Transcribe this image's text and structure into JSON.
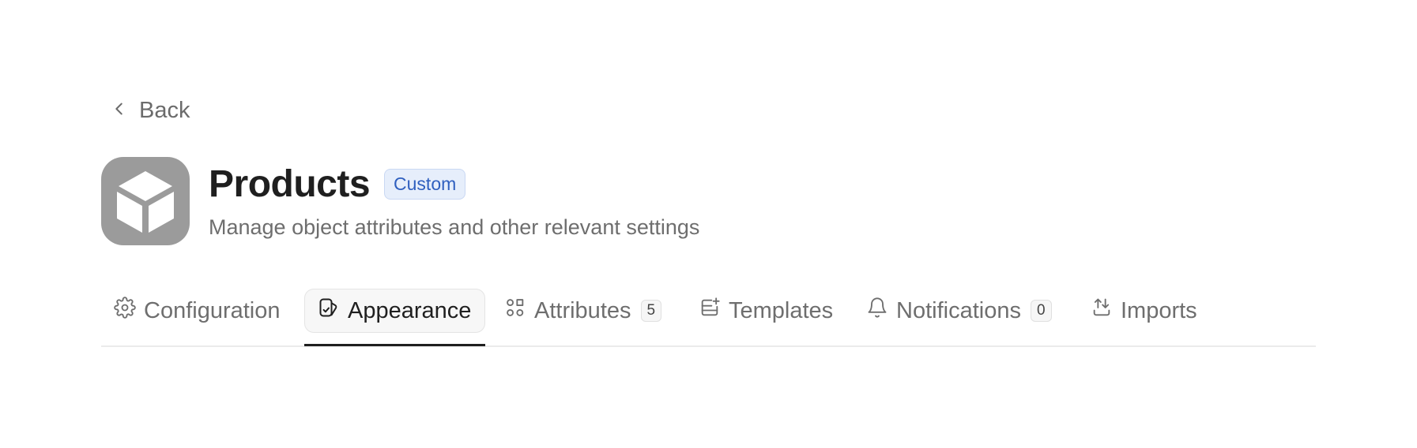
{
  "nav": {
    "back_label": "Back"
  },
  "header": {
    "icon": "cube-icon",
    "title": "Products",
    "badge": "Custom",
    "subtitle": "Manage object attributes and other relevant settings"
  },
  "tabs": [
    {
      "label": "Configuration",
      "icon": "gear-icon",
      "active": false
    },
    {
      "label": "Appearance",
      "icon": "appearance-icon",
      "active": true
    },
    {
      "label": "Attributes",
      "icon": "attributes-icon",
      "count": "5",
      "active": false
    },
    {
      "label": "Templates",
      "icon": "templates-icon",
      "active": false
    },
    {
      "label": "Notifications",
      "icon": "bell-icon",
      "count": "0",
      "active": false
    },
    {
      "label": "Imports",
      "icon": "import-icon",
      "active": false
    }
  ],
  "colors": {
    "icon_bg": "#9b9b9b",
    "badge_bg": "#e6eefb",
    "badge_text": "#2f5fbf",
    "active_underline": "#1f1f1f"
  }
}
